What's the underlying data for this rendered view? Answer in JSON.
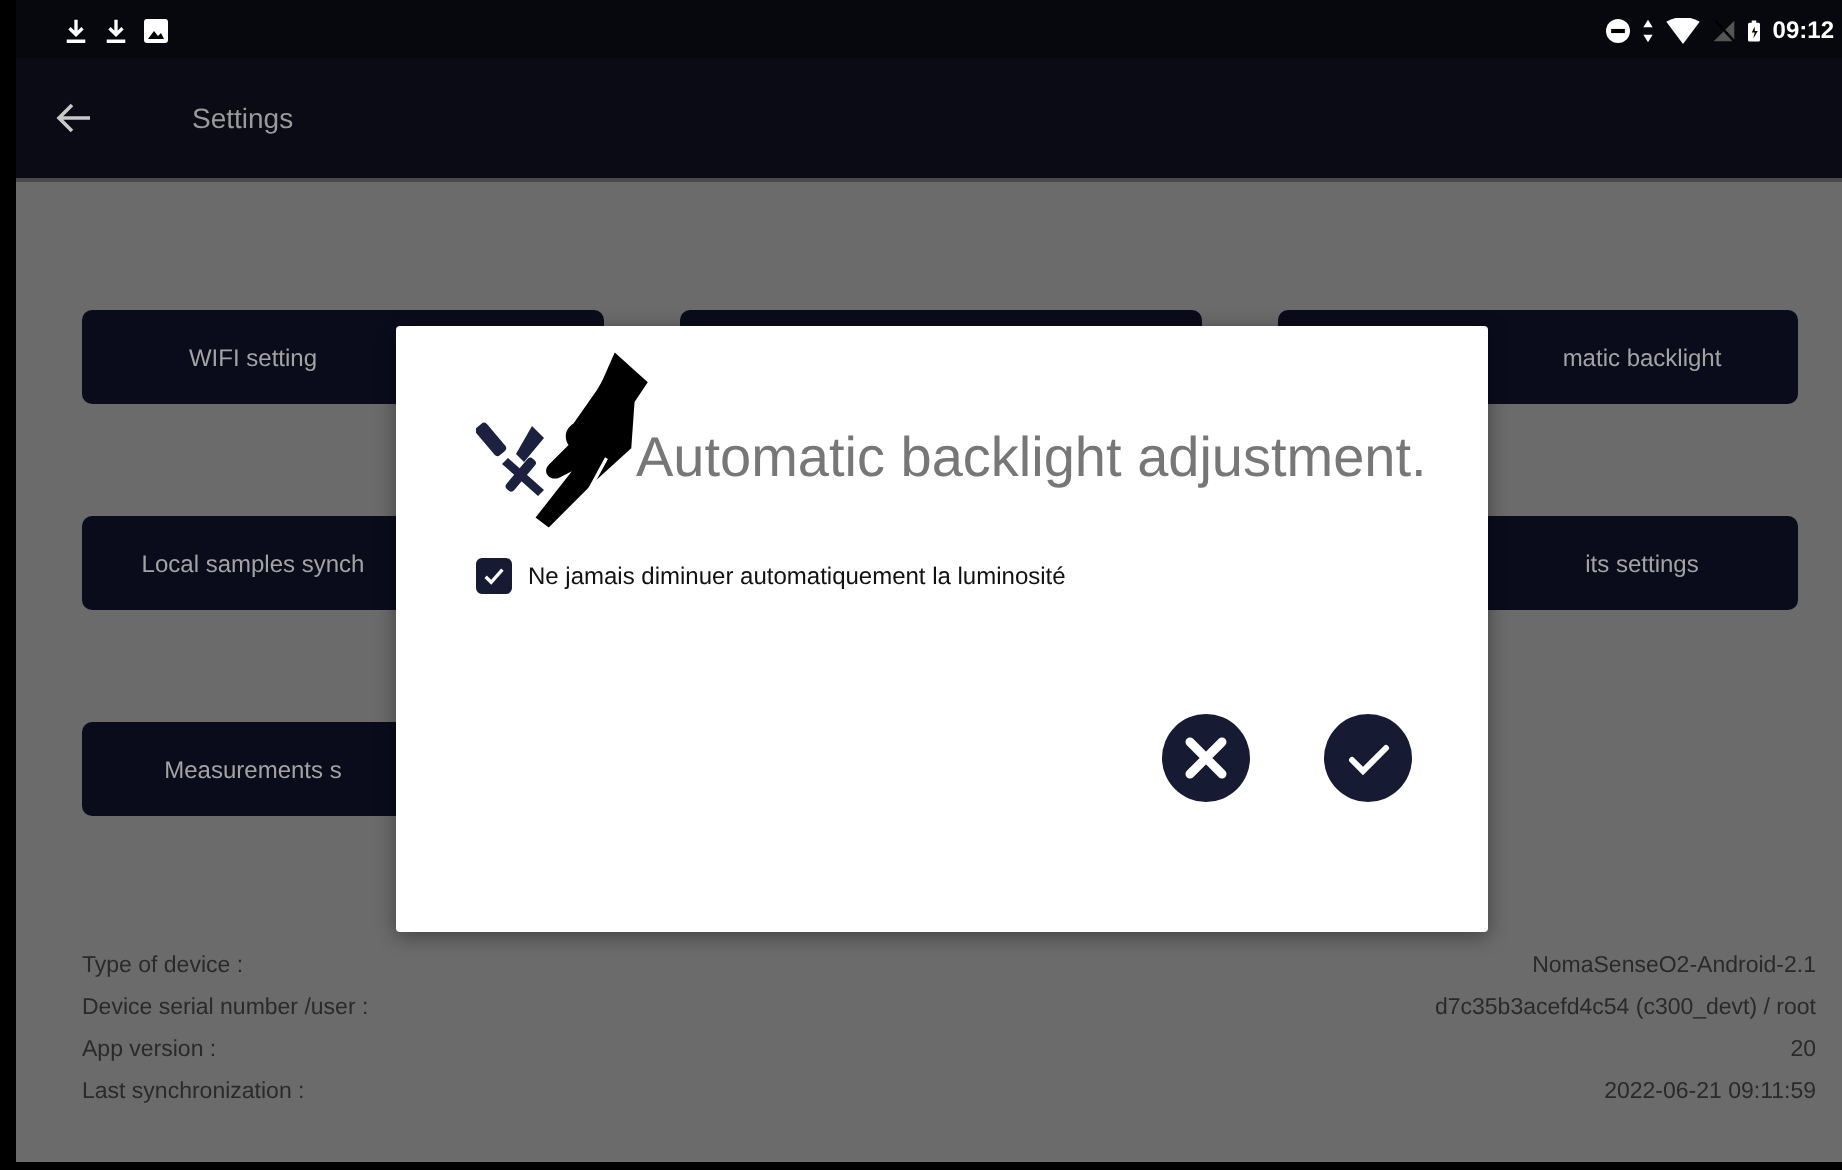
{
  "status_bar": {
    "time": "09:12"
  },
  "app_bar": {
    "title": "Settings"
  },
  "settings_buttons": [
    {
      "label": "WIFI setting",
      "kind": "leftcut"
    },
    {
      "kind": "covered"
    },
    {
      "label": "matic backlight",
      "kind": "rightcut"
    },
    {
      "label": "Local samples synch",
      "kind": "leftcut"
    },
    {
      "label": "its settings",
      "kind": "rightcut"
    },
    {
      "label": "Measurements s",
      "kind": "leftcut"
    }
  ],
  "device_info": [
    {
      "label": "Type of device :",
      "value": "NomaSenseO2-Android-2.1"
    },
    {
      "label": "Device serial number /user :",
      "value": "d7c35b3acefd4c54 (c300_devt) / root"
    },
    {
      "label": "App version :",
      "value": "20"
    },
    {
      "label": "Last synchronization :",
      "value": "2022-06-21 09:11:59"
    }
  ],
  "dialog": {
    "title": "Automatic backlight adjustment.",
    "checkbox": {
      "label": "Ne jamais diminuer automatiquement la luminosité",
      "checked": true
    },
    "buttons": [
      {
        "kind": "cancel"
      },
      {
        "kind": "confirm"
      }
    ]
  }
}
